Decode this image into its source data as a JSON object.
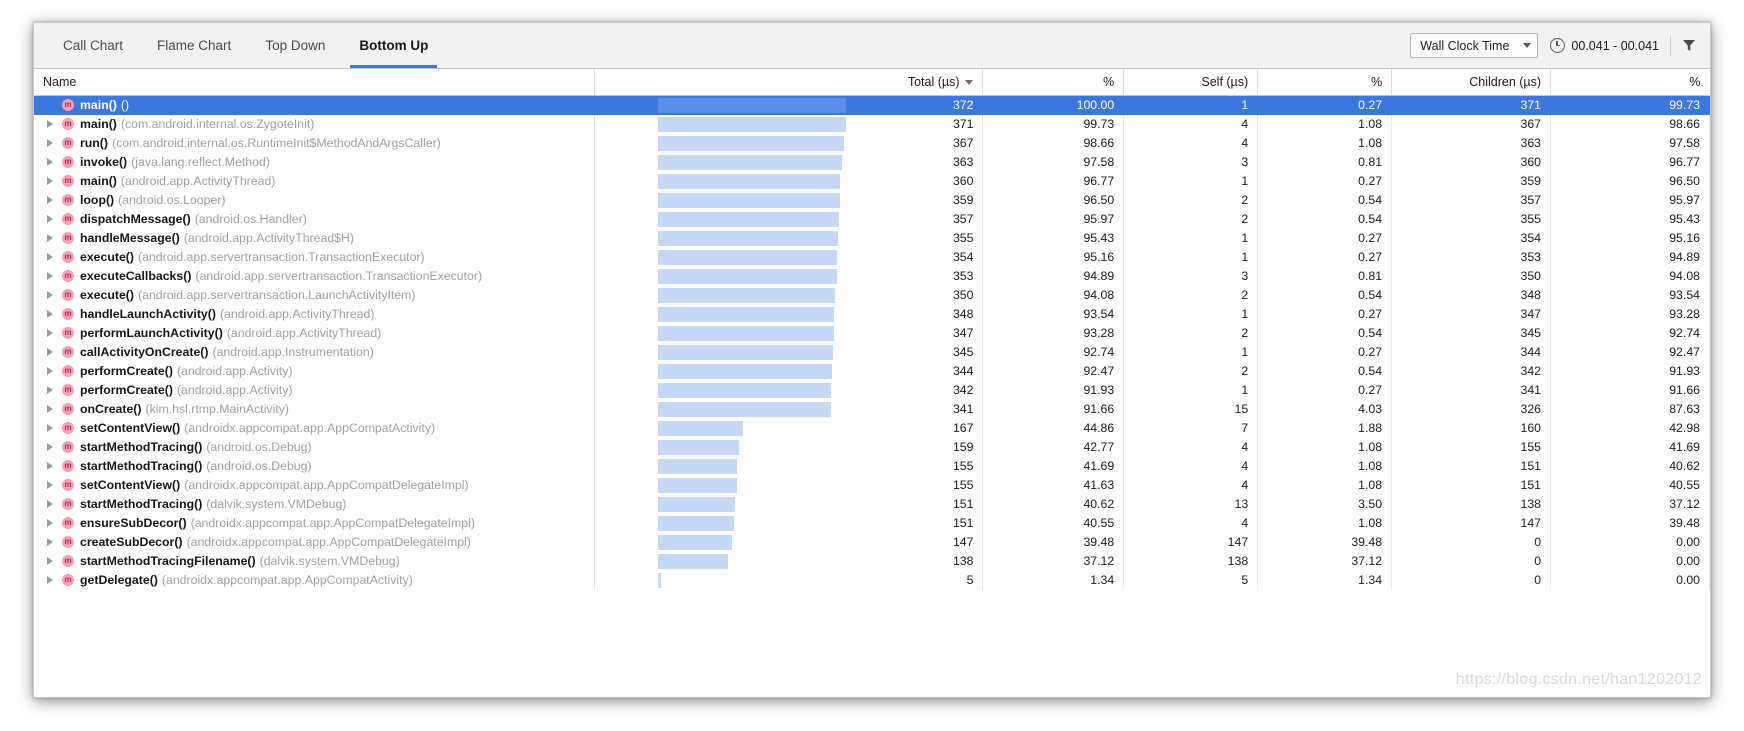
{
  "toolbar": {
    "tabs": [
      {
        "label": "Call Chart",
        "active": false
      },
      {
        "label": "Flame Chart",
        "active": false
      },
      {
        "label": "Top Down",
        "active": false
      },
      {
        "label": "Bottom Up",
        "active": true
      }
    ],
    "clock_select": {
      "value": "Wall Clock Time",
      "icon": "chevron-down-icon"
    },
    "range": {
      "icon": "clock-icon",
      "text": "00.041 - 00.041"
    },
    "filter": {
      "icon": "filter-icon",
      "label": ""
    }
  },
  "table": {
    "columns": [
      {
        "key": "name",
        "label": "Name",
        "align": "left",
        "sorted": false
      },
      {
        "key": "total",
        "label": "Total (µs)",
        "align": "right",
        "sorted": true
      },
      {
        "key": "total_pct",
        "label": "%",
        "align": "right",
        "sorted": false
      },
      {
        "key": "self",
        "label": "Self (µs)",
        "align": "right",
        "sorted": false
      },
      {
        "key": "self_pct",
        "label": "%",
        "align": "right",
        "sorted": false
      },
      {
        "key": "children",
        "label": "Children (µs)",
        "align": "right",
        "sorted": false
      },
      {
        "key": "child_pct",
        "label": "%",
        "align": "right",
        "sorted": false
      }
    ],
    "sort": {
      "column": "Total (µs)",
      "direction": "desc"
    },
    "max_total": 372,
    "rows": [
      {
        "method": "main()",
        "pkg": "()",
        "total": "372",
        "total_pct": "100.00",
        "self": "1",
        "self_pct": "0.27",
        "children": "371",
        "child_pct": "99.73",
        "bar": 100.0,
        "selected": true,
        "expandable": false
      },
      {
        "method": "main()",
        "pkg": "(com.android.internal.os.ZygoteInit)",
        "total": "371",
        "total_pct": "99.73",
        "self": "4",
        "self_pct": "1.08",
        "children": "367",
        "child_pct": "98.66",
        "bar": 99.73,
        "selected": false,
        "expandable": true
      },
      {
        "method": "run()",
        "pkg": "(com.android.internal.os.RuntimeInit$MethodAndArgsCaller)",
        "total": "367",
        "total_pct": "98.66",
        "self": "4",
        "self_pct": "1.08",
        "children": "363",
        "child_pct": "97.58",
        "bar": 98.66,
        "selected": false,
        "expandable": true
      },
      {
        "method": "invoke()",
        "pkg": "(java.lang.reflect.Method)",
        "total": "363",
        "total_pct": "97.58",
        "self": "3",
        "self_pct": "0.81",
        "children": "360",
        "child_pct": "96.77",
        "bar": 97.58,
        "selected": false,
        "expandable": true
      },
      {
        "method": "main()",
        "pkg": "(android.app.ActivityThread)",
        "total": "360",
        "total_pct": "96.77",
        "self": "1",
        "self_pct": "0.27",
        "children": "359",
        "child_pct": "96.50",
        "bar": 96.77,
        "selected": false,
        "expandable": true
      },
      {
        "method": "loop()",
        "pkg": "(android.os.Looper)",
        "total": "359",
        "total_pct": "96.50",
        "self": "2",
        "self_pct": "0.54",
        "children": "357",
        "child_pct": "95.97",
        "bar": 96.5,
        "selected": false,
        "expandable": true
      },
      {
        "method": "dispatchMessage()",
        "pkg": "(android.os.Handler)",
        "total": "357",
        "total_pct": "95.97",
        "self": "2",
        "self_pct": "0.54",
        "children": "355",
        "child_pct": "95.43",
        "bar": 95.97,
        "selected": false,
        "expandable": true
      },
      {
        "method": "handleMessage()",
        "pkg": "(android.app.ActivityThread$H)",
        "total": "355",
        "total_pct": "95.43",
        "self": "1",
        "self_pct": "0.27",
        "children": "354",
        "child_pct": "95.16",
        "bar": 95.43,
        "selected": false,
        "expandable": true
      },
      {
        "method": "execute()",
        "pkg": "(android.app.servertransaction.TransactionExecutor)",
        "total": "354",
        "total_pct": "95.16",
        "self": "1",
        "self_pct": "0.27",
        "children": "353",
        "child_pct": "94.89",
        "bar": 95.16,
        "selected": false,
        "expandable": true
      },
      {
        "method": "executeCallbacks()",
        "pkg": "(android.app.servertransaction.TransactionExecutor)",
        "total": "353",
        "total_pct": "94.89",
        "self": "3",
        "self_pct": "0.81",
        "children": "350",
        "child_pct": "94.08",
        "bar": 94.89,
        "selected": false,
        "expandable": true
      },
      {
        "method": "execute()",
        "pkg": "(android.app.servertransaction.LaunchActivityItem)",
        "total": "350",
        "total_pct": "94.08",
        "self": "2",
        "self_pct": "0.54",
        "children": "348",
        "child_pct": "93.54",
        "bar": 94.08,
        "selected": false,
        "expandable": true
      },
      {
        "method": "handleLaunchActivity()",
        "pkg": "(android.app.ActivityThread)",
        "total": "348",
        "total_pct": "93.54",
        "self": "1",
        "self_pct": "0.27",
        "children": "347",
        "child_pct": "93.28",
        "bar": 93.54,
        "selected": false,
        "expandable": true
      },
      {
        "method": "performLaunchActivity()",
        "pkg": "(android.app.ActivityThread)",
        "total": "347",
        "total_pct": "93.28",
        "self": "2",
        "self_pct": "0.54",
        "children": "345",
        "child_pct": "92.74",
        "bar": 93.28,
        "selected": false,
        "expandable": true
      },
      {
        "method": "callActivityOnCreate()",
        "pkg": "(android.app.Instrumentation)",
        "total": "345",
        "total_pct": "92.74",
        "self": "1",
        "self_pct": "0.27",
        "children": "344",
        "child_pct": "92.47",
        "bar": 92.74,
        "selected": false,
        "expandable": true
      },
      {
        "method": "performCreate()",
        "pkg": "(android.app.Activity)",
        "total": "344",
        "total_pct": "92.47",
        "self": "2",
        "self_pct": "0.54",
        "children": "342",
        "child_pct": "91.93",
        "bar": 92.47,
        "selected": false,
        "expandable": true
      },
      {
        "method": "performCreate()",
        "pkg": "(android.app.Activity)",
        "total": "342",
        "total_pct": "91.93",
        "self": "1",
        "self_pct": "0.27",
        "children": "341",
        "child_pct": "91.66",
        "bar": 91.93,
        "selected": false,
        "expandable": true
      },
      {
        "method": "onCreate()",
        "pkg": "(kim.hsl.rtmp.MainActivity)",
        "total": "341",
        "total_pct": "91.66",
        "self": "15",
        "self_pct": "4.03",
        "children": "326",
        "child_pct": "87.63",
        "bar": 91.66,
        "selected": false,
        "expandable": true
      },
      {
        "method": "setContentView()",
        "pkg": "(androidx.appcompat.app.AppCompatActivity)",
        "total": "167",
        "total_pct": "44.86",
        "self": "7",
        "self_pct": "1.88",
        "children": "160",
        "child_pct": "42.98",
        "bar": 44.86,
        "selected": false,
        "expandable": true
      },
      {
        "method": "startMethodTracing()",
        "pkg": "(android.os.Debug)",
        "total": "159",
        "total_pct": "42.77",
        "self": "4",
        "self_pct": "1.08",
        "children": "155",
        "child_pct": "41.69",
        "bar": 42.77,
        "selected": false,
        "expandable": true
      },
      {
        "method": "startMethodTracing()",
        "pkg": "(android.os.Debug)",
        "total": "155",
        "total_pct": "41.69",
        "self": "4",
        "self_pct": "1.08",
        "children": "151",
        "child_pct": "40.62",
        "bar": 41.69,
        "selected": false,
        "expandable": true
      },
      {
        "method": "setContentView()",
        "pkg": "(androidx.appcompat.app.AppCompatDelegateImpl)",
        "total": "155",
        "total_pct": "41.63",
        "self": "4",
        "self_pct": "1.08",
        "children": "151",
        "child_pct": "40.55",
        "bar": 41.63,
        "selected": false,
        "expandable": true
      },
      {
        "method": "startMethodTracing()",
        "pkg": "(dalvik.system.VMDebug)",
        "total": "151",
        "total_pct": "40.62",
        "self": "13",
        "self_pct": "3.50",
        "children": "138",
        "child_pct": "37.12",
        "bar": 40.62,
        "selected": false,
        "expandable": true
      },
      {
        "method": "ensureSubDecor()",
        "pkg": "(androidx.appcompat.app.AppCompatDelegateImpl)",
        "total": "151",
        "total_pct": "40.55",
        "self": "4",
        "self_pct": "1.08",
        "children": "147",
        "child_pct": "39.48",
        "bar": 40.55,
        "selected": false,
        "expandable": true
      },
      {
        "method": "createSubDecor()",
        "pkg": "(androidx.appcompat.app.AppCompatDelegateImpl)",
        "total": "147",
        "total_pct": "39.48",
        "self": "147",
        "self_pct": "39.48",
        "children": "0",
        "child_pct": "0.00",
        "bar": 39.48,
        "selected": false,
        "expandable": true
      },
      {
        "method": "startMethodTracingFilename()",
        "pkg": "(dalvik.system.VMDebug)",
        "total": "138",
        "total_pct": "37.12",
        "self": "138",
        "self_pct": "37.12",
        "children": "0",
        "child_pct": "0.00",
        "bar": 37.12,
        "selected": false,
        "expandable": true
      },
      {
        "method": "getDelegate()",
        "pkg": "(androidx.appcompat.app.AppCompatActivity)",
        "total": "5",
        "total_pct": "1.34",
        "self": "5",
        "self_pct": "1.34",
        "children": "0",
        "child_pct": "0.00",
        "bar": 1.34,
        "selected": false,
        "expandable": true
      }
    ]
  },
  "watermark": {
    "text": "https://blog.csdn.net/han1202012"
  },
  "colors": {
    "selection": "#3b77dd",
    "bar": "#c5d9f7",
    "bar_selected": "#5a8ee8",
    "method_icon_bg": "#f5a0b5",
    "package_text": "#a0a0a0",
    "tab_underline": "#3b77dd"
  }
}
